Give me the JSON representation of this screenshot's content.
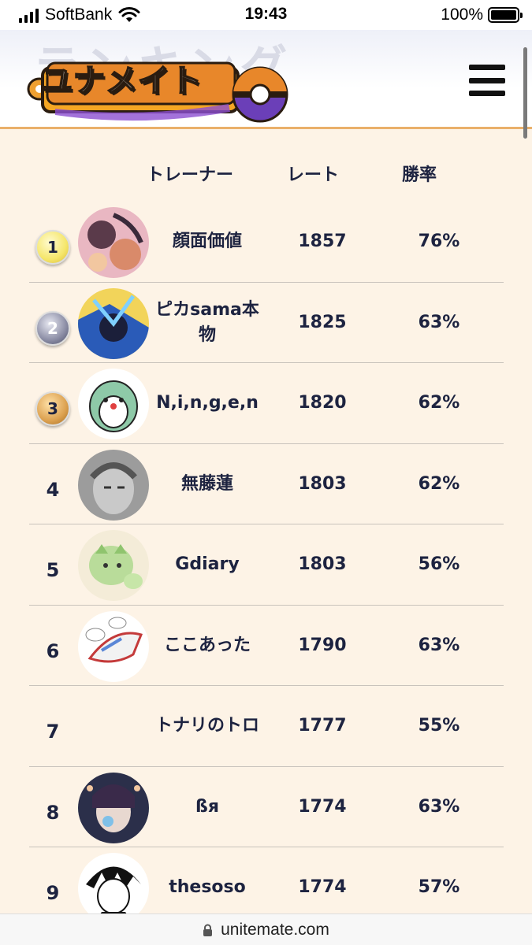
{
  "status_bar": {
    "carrier": "SoftBank",
    "time": "19:43",
    "battery": "100%"
  },
  "header": {
    "logo_text": "ユナメイト",
    "ghost_title": "ランキング"
  },
  "columns": {
    "trainer": "トレーナー",
    "rate": "レート",
    "winrate": "勝率"
  },
  "ranking": [
    {
      "rank": "1",
      "name": "顔面価値",
      "rate": "1857",
      "winrate": "76%",
      "avatar": "avatar-1"
    },
    {
      "rank": "2",
      "name": "ピカsama本物",
      "rate": "1825",
      "winrate": "63%",
      "avatar": "avatar-2"
    },
    {
      "rank": "3",
      "name": "N,i,n,g,e,n",
      "rate": "1820",
      "winrate": "62%",
      "avatar": "avatar-3"
    },
    {
      "rank": "4",
      "name": "無藤蓮",
      "rate": "1803",
      "winrate": "62%",
      "avatar": "avatar-4"
    },
    {
      "rank": "5",
      "name": "Gdiary",
      "rate": "1803",
      "winrate": "56%",
      "avatar": "avatar-5"
    },
    {
      "rank": "6",
      "name": "ここあった",
      "rate": "1790",
      "winrate": "63%",
      "avatar": "avatar-6"
    },
    {
      "rank": "7",
      "name": "トナリのトロ",
      "rate": "1777",
      "winrate": "55%",
      "avatar": ""
    },
    {
      "rank": "8",
      "name": "ßя",
      "rate": "1774",
      "winrate": "63%",
      "avatar": "avatar-8"
    },
    {
      "rank": "9",
      "name": "thesoso",
      "rate": "1774",
      "winrate": "57%",
      "avatar": "avatar-9"
    }
  ],
  "url_bar": {
    "domain": "unitemate.com"
  },
  "colors": {
    "background": "#fdf3e6",
    "text": "#1d2340",
    "header_border": "#eab06a"
  }
}
